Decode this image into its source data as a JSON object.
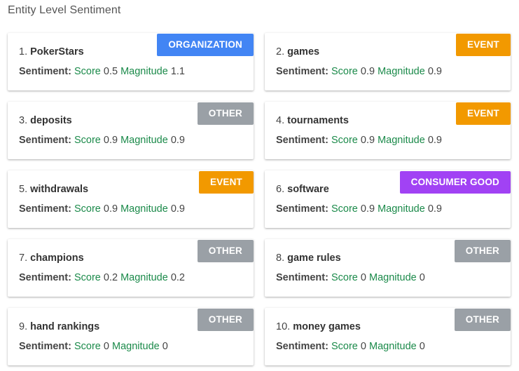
{
  "header": {
    "title": "Entity Level Sentiment"
  },
  "labels": {
    "sentiment": "Sentiment:",
    "score": "Score",
    "magnitude": "Magnitude"
  },
  "colors": {
    "ORGANIZATION": "#4285f4",
    "EVENT": "#f29900",
    "OTHER": "#9aa0a6",
    "CONSUMER GOOD": "#a142f4"
  },
  "entities": [
    {
      "index": "1.",
      "name": "PokerStars",
      "type": "ORGANIZATION",
      "score": "0.5",
      "magnitude": "1.1"
    },
    {
      "index": "2.",
      "name": "games",
      "type": "EVENT",
      "score": "0.9",
      "magnitude": "0.9"
    },
    {
      "index": "3.",
      "name": "deposits",
      "type": "OTHER",
      "score": "0.9",
      "magnitude": "0.9"
    },
    {
      "index": "4.",
      "name": "tournaments",
      "type": "EVENT",
      "score": "0.9",
      "magnitude": "0.9"
    },
    {
      "index": "5.",
      "name": "withdrawals",
      "type": "EVENT",
      "score": "0.9",
      "magnitude": "0.9"
    },
    {
      "index": "6.",
      "name": "software",
      "type": "CONSUMER GOOD",
      "score": "0.9",
      "magnitude": "0.9"
    },
    {
      "index": "7.",
      "name": "champions",
      "type": "OTHER",
      "score": "0.2",
      "magnitude": "0.2"
    },
    {
      "index": "8.",
      "name": "game rules",
      "type": "OTHER",
      "score": "0",
      "magnitude": "0"
    },
    {
      "index": "9.",
      "name": "hand rankings",
      "type": "OTHER",
      "score": "0",
      "magnitude": "0"
    },
    {
      "index": "10.",
      "name": "money games",
      "type": "OTHER",
      "score": "0",
      "magnitude": "0"
    }
  ]
}
